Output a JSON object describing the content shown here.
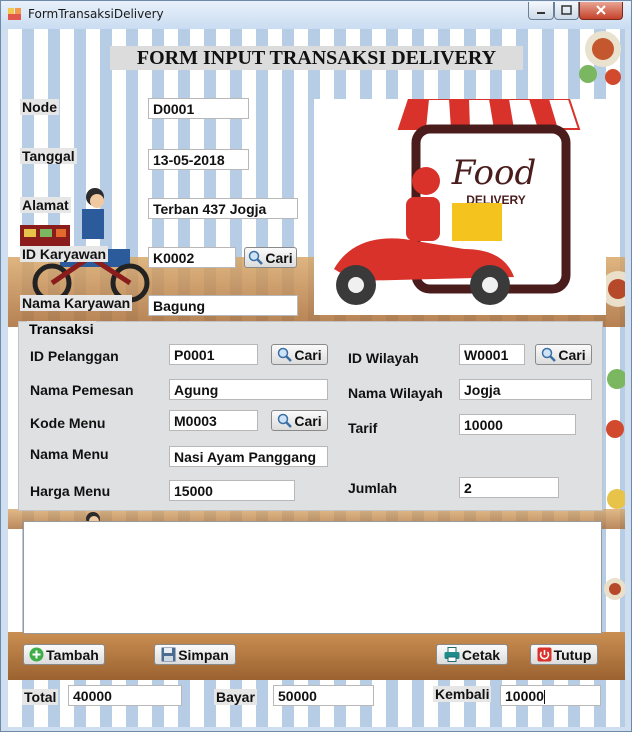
{
  "window": {
    "title": "FormTransaksiDelivery"
  },
  "form_title": "FORM INPUT TRANSAKSI DELIVERY",
  "header": {
    "node_label": "Node",
    "node_value": "D0001",
    "tanggal_label": "Tanggal",
    "tanggal_value": "13-05-2018",
    "alamat_label": "Alamat",
    "alamat_value": "Terban 437 Jogja",
    "id_karyawan_label": "ID Karyawan",
    "id_karyawan_value": "K0002",
    "nama_karyawan_label": "Nama Karyawan",
    "nama_karyawan_value": "Bagung",
    "cari_label": "Cari"
  },
  "food_logo": {
    "line1": "Food",
    "line2": "DELIVERY"
  },
  "transaksi": {
    "title": "Transaksi",
    "id_pelanggan_label": "ID Pelanggan",
    "id_pelanggan_value": "P0001",
    "nama_pemesan_label": "Nama Pemesan",
    "nama_pemesan_value": "Agung",
    "kode_menu_label": "Kode Menu",
    "kode_menu_value": "M0003",
    "nama_menu_label": "Nama Menu",
    "nama_menu_value": "Nasi Ayam Panggang",
    "harga_menu_label": "Harga Menu",
    "harga_menu_value": "15000",
    "id_wilayah_label": "ID Wilayah",
    "id_wilayah_value": "W0001",
    "nama_wilayah_label": "Nama Wilayah",
    "nama_wilayah_value": "Jogja",
    "tarif_label": "Tarif",
    "tarif_value": "10000",
    "jumlah_label": "Jumlah",
    "jumlah_value": "2",
    "cari_label": "Cari"
  },
  "actions": {
    "tambah": "Tambah",
    "simpan": "Simpan",
    "cetak": "Cetak",
    "tutup": "Tutup"
  },
  "totals": {
    "total_label": "Total",
    "total_value": "40000",
    "bayar_label": "Bayar",
    "bayar_value": "50000",
    "kembali_label": "Kembali",
    "kembali_value": "10000"
  },
  "icons": {
    "app": "app-icon",
    "search": "magnifier-icon",
    "add": "plus-circle-icon",
    "save": "floppy-icon",
    "print": "printer-icon",
    "power": "power-icon"
  },
  "colors": {
    "accent_red": "#d9322b",
    "stripe_blue": "#b7cde6",
    "wood": "#b57a40"
  }
}
